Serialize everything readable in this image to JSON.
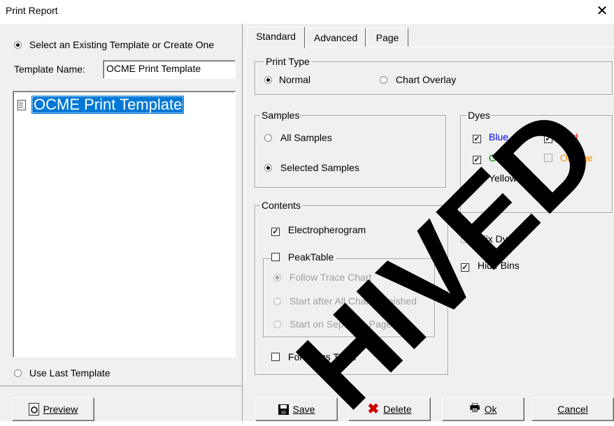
{
  "window": {
    "title": "Print Report",
    "close": "✕"
  },
  "left": {
    "select_existing": "Select an Existing Template or Create One",
    "template_name_label": "Template Name:",
    "template_name_value": "OCME Print Template",
    "list_items": [
      "OCME Print Template"
    ],
    "use_last": "Use Last Template"
  },
  "tabs": [
    "Standard",
    "Advanced",
    "Page"
  ],
  "print_type": {
    "label": "Print Type",
    "normal": "Normal",
    "overlay": "Chart Overlay"
  },
  "samples": {
    "label": "Samples",
    "all": "All Samples",
    "selected": "Selected Samples"
  },
  "dyes": {
    "label": "Dyes",
    "items": [
      {
        "name": "Blue",
        "color": "#0000ff",
        "checked": true
      },
      {
        "name": "Red",
        "color": "#ff0000",
        "checked": true
      },
      {
        "name": "Green",
        "color": "#008000",
        "checked": true
      },
      {
        "name": "Orange",
        "color": "#ff8c00",
        "checked": false
      },
      {
        "name": "Yellow",
        "color": "#000000",
        "checked": true
      }
    ]
  },
  "contents": {
    "label": "Contents",
    "electropherogram": "Electropherogram",
    "peak_table": "PeakTable",
    "follow_trace": "Follow Trace Chart",
    "start_after": "Start after All Charts Finished",
    "start_separate": "Start on Separate Page",
    "forensics": "Forensics Table"
  },
  "options": {
    "mix_dyes": "Mix Dyes",
    "hide_bins": "Hide Bins"
  },
  "buttons": {
    "preview": "Preview",
    "save": "Save",
    "delete": "Delete",
    "ok": "Ok",
    "cancel": "Cancel"
  },
  "watermark": "HIVED"
}
